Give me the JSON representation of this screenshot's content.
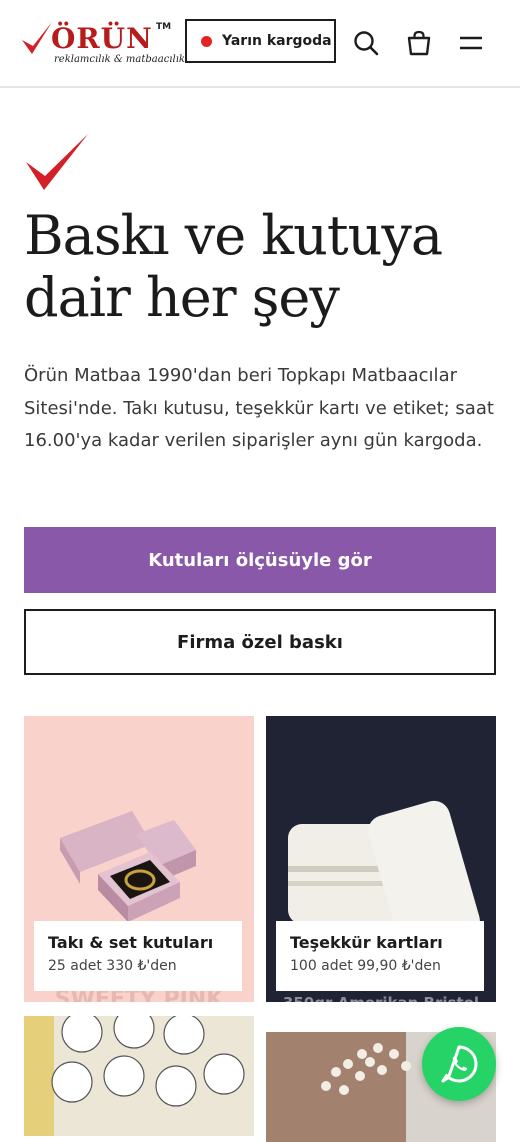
{
  "header": {
    "logo_text": "ÖRÜN",
    "logo_tm": "TM",
    "logo_sub": "reklamcılık & matbaacılık",
    "shipping_label": "Yarın kargoda"
  },
  "hero": {
    "title": "Baskı ve kutuya dair her şey",
    "description": "Örün Matbaa 1990'dan beri Topkapı Matbaacılar Sitesi'nde. Takı kutusu, teşekkür kartı ve etiket; saat 16.00'ya kadar verilen siparişler aynı gün kargoda.",
    "primary_button": "Kutuları ölçüsüyle gör",
    "secondary_button": "Firma özel baskı"
  },
  "cards": [
    {
      "title": "Takı & set kutuları",
      "price": "25 adet 330 ₺'den",
      "image_text": "SWEETY PINK"
    },
    {
      "title": "Teşekkür kartları",
      "price": "100 adet 99,90 ₺'den",
      "image_text": "350gr Amerikan Bristol"
    },
    {
      "title": "",
      "price": ""
    },
    {
      "title": "",
      "price": ""
    }
  ],
  "colors": {
    "accent": "#8a58a8",
    "brand_red": "#d32027",
    "ship_dot": "#e52222",
    "whatsapp": "#25d366"
  },
  "icons": {
    "search": "search-icon",
    "bag": "bag-icon",
    "menu": "menu-icon",
    "whatsapp": "whatsapp-icon"
  }
}
